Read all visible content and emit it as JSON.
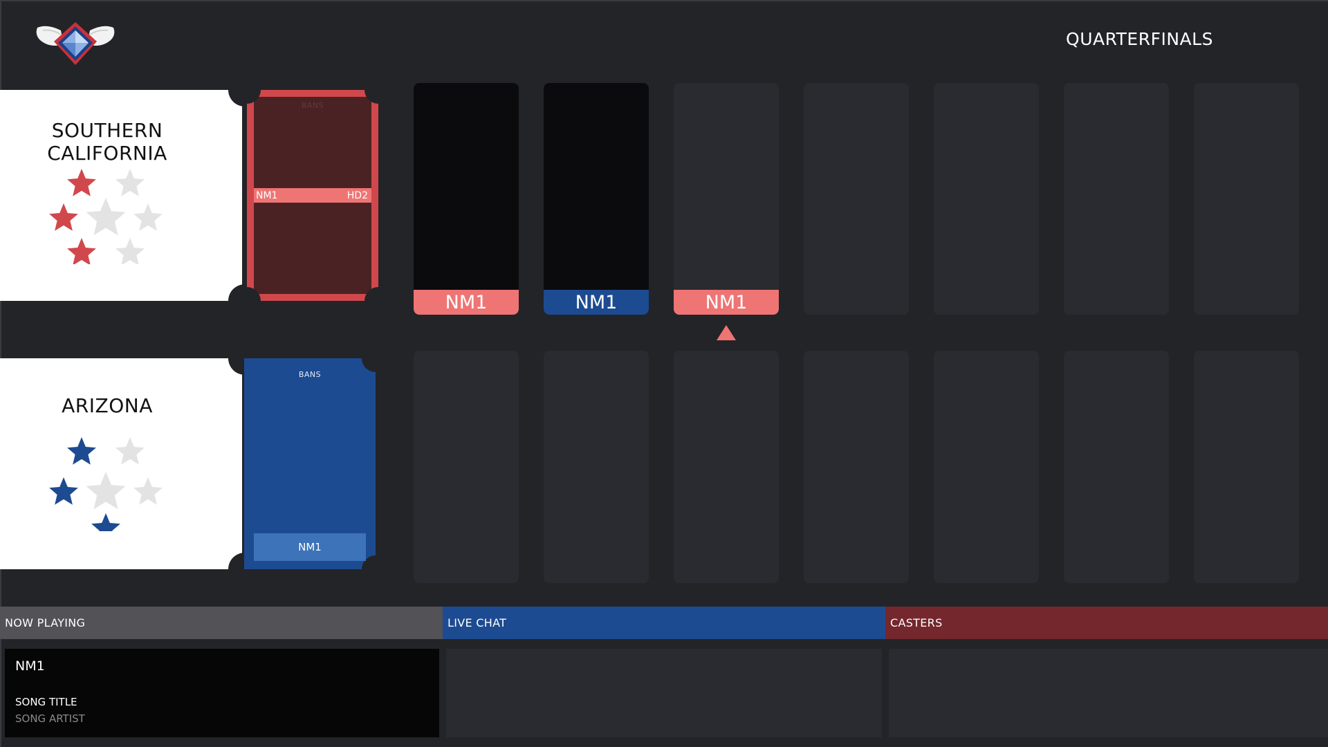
{
  "round": "QUARTERFINALS",
  "teams": {
    "red": {
      "name_line1": "SOUTHERN",
      "name_line2": "CALIFORNIA",
      "color": "#d1484c",
      "stars_won": 3,
      "stars_total": 7
    },
    "blue": {
      "name_line1": "ARIZONA",
      "name_line2": "",
      "color": "#1d4b91",
      "stars_won": 3,
      "stars_total": 7
    }
  },
  "bans": {
    "label": "BANS",
    "red": [
      "NM1",
      "HD2"
    ],
    "blue": [
      "NM1"
    ]
  },
  "picks": {
    "red_row": [
      {
        "label": "NM1",
        "team": "red",
        "filled": true
      },
      {
        "label": "NM1",
        "team": "blue",
        "filled": true
      },
      {
        "label": "NM1",
        "team": "red",
        "filled": false,
        "current": true
      },
      {
        "label": "",
        "filled": false
      },
      {
        "label": "",
        "filled": false
      },
      {
        "label": "",
        "filled": false
      },
      {
        "label": "",
        "filled": false
      }
    ],
    "blue_row_count": 7
  },
  "bottom": {
    "now_playing_label": "NOW PLAYING",
    "live_chat_label": "LIVE CHAT",
    "casters_label": "CASTERS",
    "now_playing": {
      "map": "NM1",
      "song_title": "SONG TITLE",
      "song_artist": "SONG ARTIST"
    }
  },
  "colors": {
    "background": "#232428",
    "red": "#d1484c",
    "red_light": "#ef7474",
    "blue": "#1d4b91",
    "casters": "#74272d",
    "now_playing_header": "#525257"
  }
}
